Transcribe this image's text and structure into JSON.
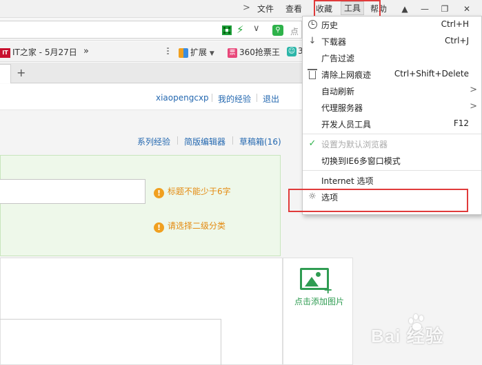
{
  "menubar": {
    "items": [
      "文件",
      "查看",
      "收藏",
      "工具",
      "帮助"
    ],
    "active_index": 3
  },
  "addressbar": {
    "hint_text": "点"
  },
  "bookmarks": {
    "it_badge": "IT",
    "it_home": "IT之家 - 5月27日",
    "more": "»",
    "extensions": "扩展",
    "ticket_badge": "票",
    "ticket": "360抢票王",
    "next_item": "3"
  },
  "tabs": {
    "close_glyph": "×",
    "new_tab_glyph": "+"
  },
  "userbar": {
    "username": "xiaopengcxp",
    "my_experience": "我的经验",
    "logout": "退出"
  },
  "subnav": {
    "series": "系列经验",
    "simple_editor": "简版编辑器",
    "drafts": "草稿箱(16)"
  },
  "form": {
    "title_warning": "标题不能少于6字",
    "category_warning": "请选择二级分类",
    "add_image": "点击添加图片"
  },
  "tools_menu": {
    "items": [
      {
        "label": "历史",
        "shortcut": "Ctrl+H"
      },
      {
        "label": "下载器",
        "shortcut": "Ctrl+J"
      },
      {
        "label": "广告过滤"
      },
      {
        "label": "清除上网痕迹",
        "shortcut": "Ctrl+Shift+Delete"
      },
      {
        "label": "自动刷新"
      },
      {
        "label": "代理服务器"
      },
      {
        "label": "开发人员工具",
        "shortcut": "F12"
      },
      {
        "label": "设置为默认浏览器"
      },
      {
        "label": "切换到IE6多窗口模式"
      },
      {
        "label": "Internet 选项"
      },
      {
        "label": "选项"
      }
    ]
  },
  "watermark": {
    "text": "Bai  经验"
  },
  "colors": {
    "highlight_box": "#e03a3a",
    "link_blue": "#2468b0",
    "warning_orange": "#e48a10",
    "accent_green": "#2f9c52"
  }
}
